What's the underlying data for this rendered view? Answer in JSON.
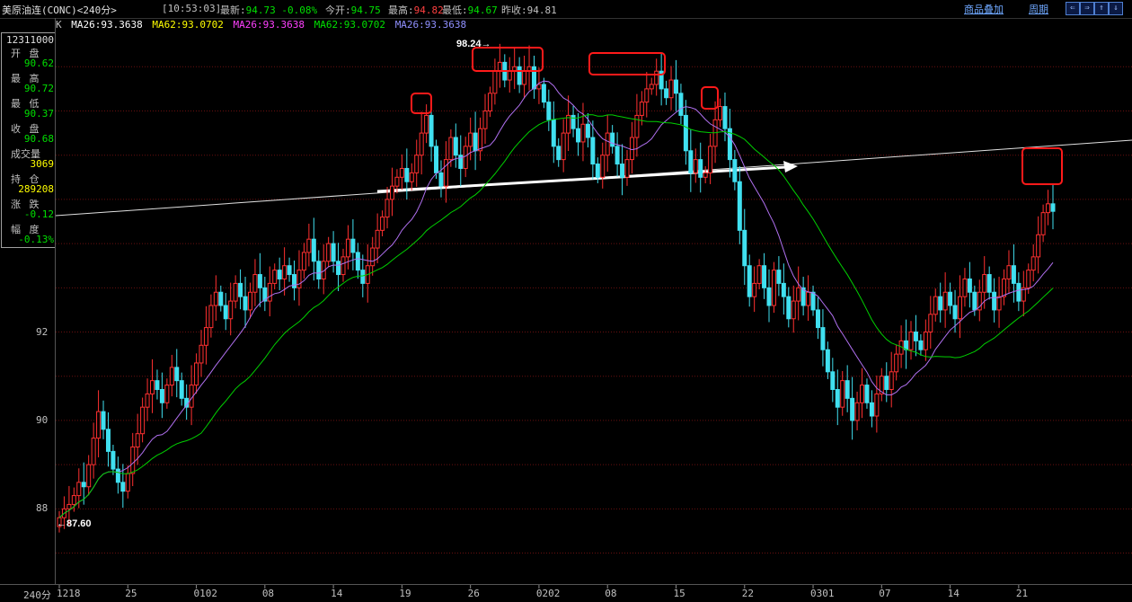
{
  "header": {
    "title": "美原油连(CONC)<240分>",
    "time": "[10:53:03]",
    "latest_label": "最新:",
    "latest_value": "94.73",
    "latest_change": "-0.08%",
    "open_label": "今开:",
    "open_value": "94.75",
    "high_label": "最高:",
    "high_value": "94.82",
    "low_label": "最低:",
    "low_value": "94.67",
    "prev_label": "昨收:",
    "prev_value": "94.81",
    "overlay_link": "商品叠加",
    "period_link": "周期",
    "nav_buttons": [
      "⇐",
      "⇒",
      "⇑",
      "⇓",
      "▦"
    ]
  },
  "legend": {
    "kind": "K",
    "ma1": "MA26:93.3638",
    "ma2": "MA62:93.0702",
    "ma3": "MA26:93.3638",
    "ma4": "MA62:93.0702",
    "ma5": "MA26:93.3638",
    "colors": {
      "ma26": "#b070f0",
      "ma62": "#00d000",
      "ma26b": "#ff40ff"
    }
  },
  "info_panel": {
    "time_code": "12311000",
    "open_label": "开 盘",
    "open_value": "90.62",
    "high_label": "最 高",
    "high_value": "90.72",
    "low_label": "最 低",
    "low_value": "90.37",
    "close_label": "收 盘",
    "close_value": "90.68",
    "volume_label": "成交量",
    "volume_value": "3069",
    "oi_label": "持 仓",
    "oi_value": "289208",
    "change_label": "涨 跌",
    "change_value": "-0.12",
    "pct_label": "幅 度",
    "pct_value": "-0.13%"
  },
  "period_label": "240分",
  "chart_data": {
    "type": "candlestick",
    "y_ticks": [
      "88",
      "90",
      "92"
    ],
    "ylim": [
      86.3,
      98.9
    ],
    "x_ticks": [
      "1218",
      "25",
      "0102",
      "08",
      "14",
      "19",
      "26",
      "0202",
      "08",
      "15",
      "22",
      "0301",
      "07",
      "14",
      "21"
    ],
    "x_tick_index": [
      0,
      14,
      28,
      42,
      56,
      70,
      84,
      98,
      112,
      126,
      140,
      154,
      168,
      182,
      196
    ],
    "annotations": {
      "max_label": "98.24",
      "min_label": "87.60"
    },
    "series": {
      "close": [
        87.8,
        88.0,
        88.1,
        88.3,
        88.6,
        88.5,
        89.0,
        89.6,
        90.2,
        89.8,
        89.3,
        88.9,
        88.6,
        88.4,
        88.8,
        89.4,
        89.7,
        90.3,
        90.6,
        90.9,
        90.7,
        90.4,
        90.8,
        91.2,
        90.9,
        90.5,
        90.3,
        90.8,
        91.3,
        91.7,
        92.1,
        92.6,
        92.9,
        92.6,
        92.3,
        92.7,
        93.1,
        92.8,
        92.5,
        92.9,
        93.3,
        93.0,
        92.7,
        93.1,
        93.4,
        93.2,
        93.5,
        93.3,
        93.0,
        93.4,
        93.8,
        94.1,
        93.6,
        93.2,
        93.6,
        94.0,
        93.6,
        93.3,
        93.7,
        94.1,
        93.8,
        93.4,
        93.1,
        93.5,
        93.9,
        94.3,
        94.6,
        95.0,
        95.3,
        95.5,
        95.7,
        95.4,
        95.6,
        96.0,
        96.5,
        96.9,
        96.2,
        95.6,
        95.3,
        95.9,
        96.4,
        96.0,
        95.7,
        96.2,
        96.5,
        96.1,
        96.6,
        97.0,
        97.4,
        97.9,
        98.1,
        97.7,
        97.9,
        98.0,
        97.6,
        97.9,
        98.0,
        97.5,
        97.6,
        97.2,
        96.8,
        96.2,
        95.9,
        96.5,
        96.9,
        96.6,
        96.3,
        96.7,
        96.4,
        95.8,
        95.5,
        96.0,
        96.5,
        96.2,
        95.8,
        95.5,
        95.9,
        96.4,
        96.9,
        97.2,
        97.5,
        97.6,
        97.9,
        97.5,
        97.3,
        97.7,
        97.4,
        96.9,
        96.1,
        95.6,
        95.9,
        95.5,
        95.6,
        96.2,
        96.8,
        97.1,
        96.6,
        95.9,
        95.4,
        94.3,
        93.5,
        92.8,
        93.1,
        93.5,
        93.0,
        92.6,
        93.4,
        93.1,
        92.8,
        92.3,
        92.7,
        93.0,
        92.6,
        92.9,
        92.5,
        92.1,
        91.6,
        91.1,
        90.7,
        90.3,
        90.9,
        90.5,
        90.0,
        90.4,
        90.8,
        90.4,
        90.1,
        90.6,
        91.0,
        90.7,
        91.1,
        91.5,
        91.8,
        91.6,
        92.0,
        91.8,
        91.6,
        92.0,
        92.4,
        92.8,
        92.5,
        92.9,
        92.6,
        92.3,
        92.8,
        93.2,
        92.9,
        92.5,
        92.9,
        93.3,
        92.9,
        92.5,
        92.8,
        93.2,
        93.5,
        93.1,
        92.7,
        93.0,
        93.4,
        93.7,
        94.2,
        94.7,
        94.9,
        94.73
      ]
    }
  }
}
